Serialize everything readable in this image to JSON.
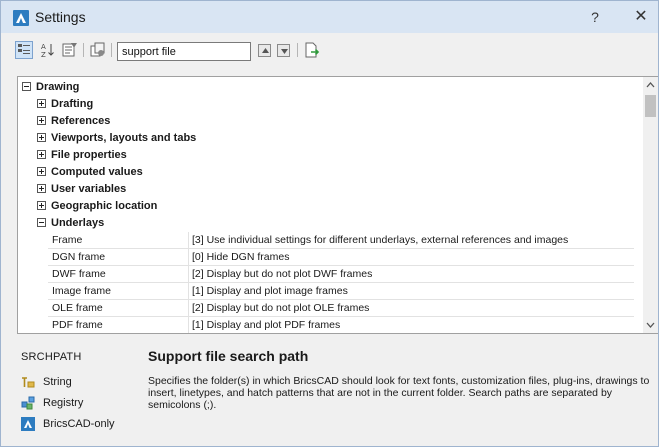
{
  "window": {
    "title": "Settings",
    "help_label": "?",
    "close_label": "✕",
    "accent": "#2d7cc0",
    "titlebar_bg": "#d9e5f3"
  },
  "toolbar": {
    "search_value": "support file",
    "buttons": [
      "categorized-view-icon",
      "alphabetic-view-icon",
      "filter-icon",
      "settings-differences-icon",
      "previous-match-icon",
      "next-match-icon",
      "export-icon"
    ]
  },
  "tree": {
    "root": "Drawing",
    "categories": [
      "Drafting",
      "References",
      "Viewports, layouts and tabs",
      "File properties",
      "Computed values",
      "User variables",
      "Geographic location",
      "Underlays"
    ],
    "properties": [
      {
        "name": "Frame",
        "value": "[3] Use individual settings for different underlays, external references and images"
      },
      {
        "name": "DGN frame",
        "value": "[0] Hide DGN frames"
      },
      {
        "name": "DWF frame",
        "value": "[2] Display but do not plot DWF frames"
      },
      {
        "name": "Image frame",
        "value": "[1] Display and plot image frames"
      },
      {
        "name": "OLE frame",
        "value": "[2] Display but do not plot OLE frames"
      },
      {
        "name": "PDF frame",
        "value": "[1] Display and plot PDF frames"
      }
    ]
  },
  "info": {
    "variable_name": "SRCHPATH",
    "title": "Support file search path",
    "description": "Specifies the folder(s) in which BricsCAD should look for text fonts, customization files, plug-ins, drawings to insert, linetypes, and hatch patterns that are not in the current folder. Search paths are separated by semicolons (;).",
    "type_label": "String",
    "storage_label": "Registry",
    "scope_label": "BricsCAD-only"
  }
}
